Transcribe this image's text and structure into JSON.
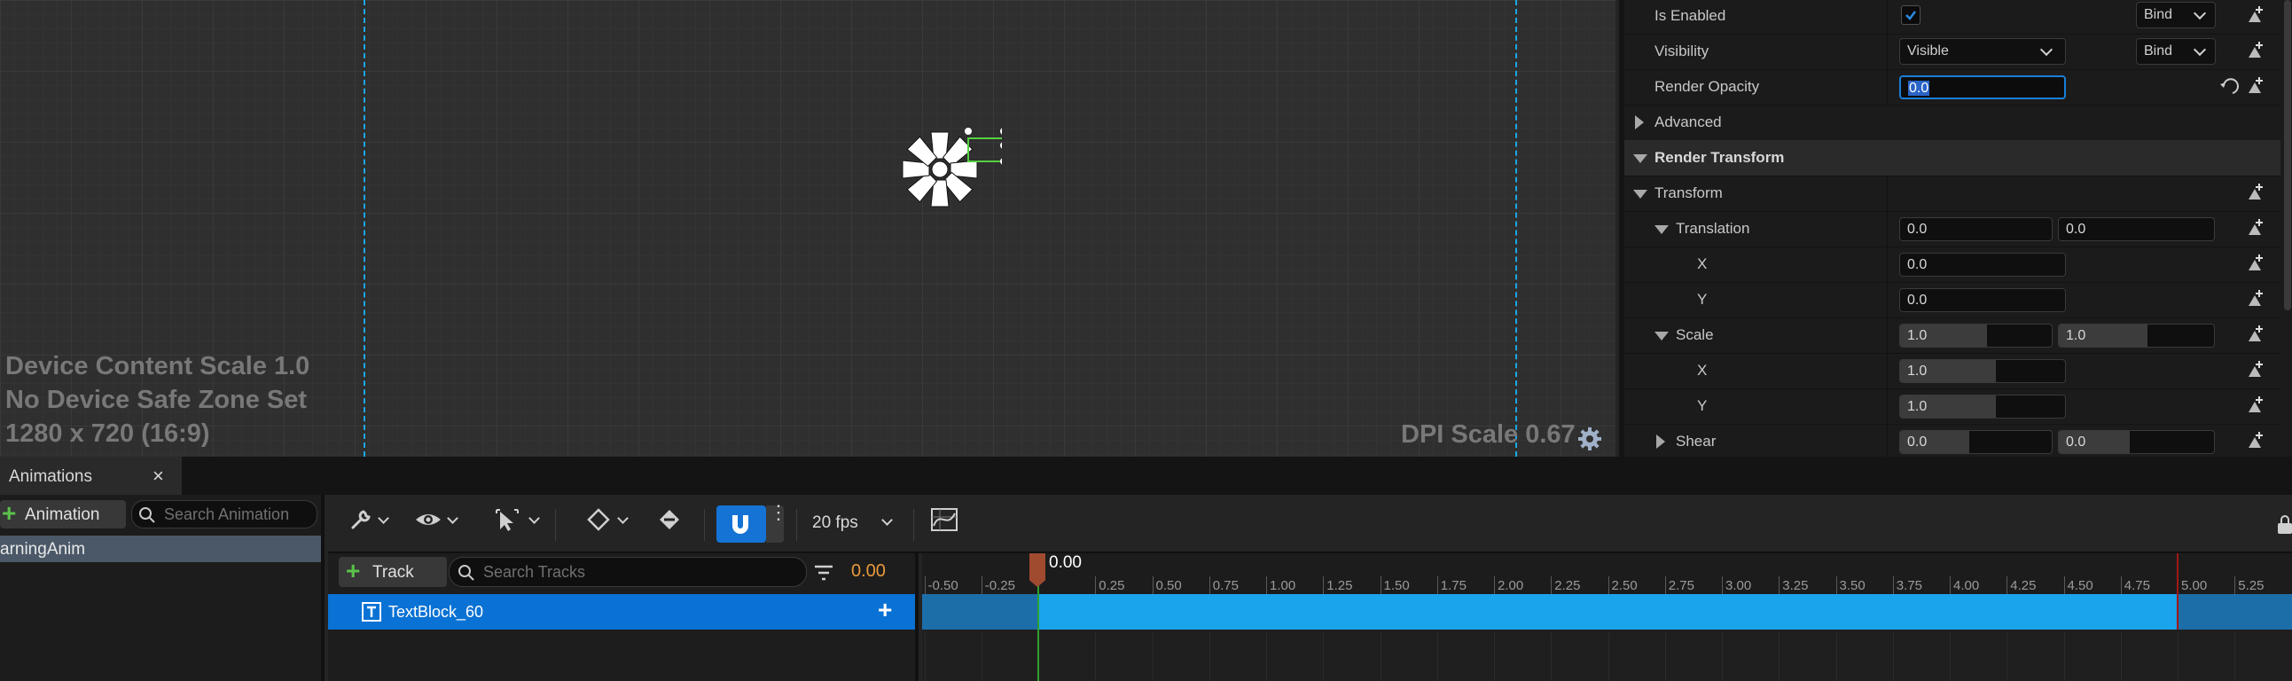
{
  "viewport": {
    "info_lines": [
      "Device Content Scale 1.0",
      "No Device Safe Zone Set",
      "1280 x 720 (16:9)"
    ],
    "dpi_scale": "DPI Scale 0.67"
  },
  "details": {
    "is_enabled": {
      "label": "Is Enabled",
      "bind_label": "Bind"
    },
    "visibility": {
      "label": "Visibility",
      "value": "Visible",
      "bind_label": "Bind"
    },
    "render_opacity": {
      "label": "Render Opacity",
      "value": "0.0"
    },
    "advanced": {
      "label": "Advanced"
    },
    "render_transform": {
      "label": "Render Transform"
    },
    "transform": {
      "label": "Transform"
    },
    "translation": {
      "label": "Translation",
      "x": "0.0",
      "y": "0.0",
      "x_label": "X",
      "y_label": "Y",
      "x_value": "0.0",
      "y_value": "0.0"
    },
    "scale": {
      "label": "Scale",
      "x": "1.0",
      "y": "1.0",
      "x_label": "X",
      "y_label": "Y",
      "x_value": "1.0",
      "y_value": "1.0"
    },
    "shear": {
      "label": "Shear",
      "x": "0.0",
      "y": "0.0"
    }
  },
  "animations_panel": {
    "tab_title": "Animations",
    "add_button": "Animation",
    "search_placeholder": "Search Animation",
    "items": [
      "arningAnim"
    ]
  },
  "sequencer": {
    "fps_label": "20 fps",
    "add_track_button": "Track",
    "search_tracks_placeholder": "Search Tracks",
    "current_time": "0.00",
    "playhead_time": "0.00",
    "tracks": [
      {
        "name": "TextBlock_60"
      }
    ],
    "ruler_labels": [
      "-0.50",
      "-0.25",
      "0.25",
      "0.50",
      "0.75",
      "1.00",
      "1.25",
      "1.50",
      "1.75",
      "2.00",
      "2.25",
      "2.50",
      "2.75",
      "3.00",
      "3.25",
      "3.50",
      "3.75",
      "4.00",
      "4.25",
      "4.50",
      "4.75",
      "5.00",
      "5.25"
    ]
  },
  "colors": {
    "accent_blue": "#1aa8e8",
    "selection_blue": "#0a78d4",
    "playhead": "#a04a30",
    "time_orange": "#e89a3c"
  },
  "icons": [
    "checkmark-icon",
    "key-icon",
    "reset-arrow-icon",
    "settings-gear-icon",
    "wrench-icon",
    "eye-icon",
    "cursor-icon",
    "diamond-key-icon",
    "snap-magnet-icon",
    "curve-editor-icon",
    "filter-icon",
    "search-icon",
    "plus-icon",
    "text-block-icon",
    "close-icon",
    "loading-spinner-icon"
  ]
}
